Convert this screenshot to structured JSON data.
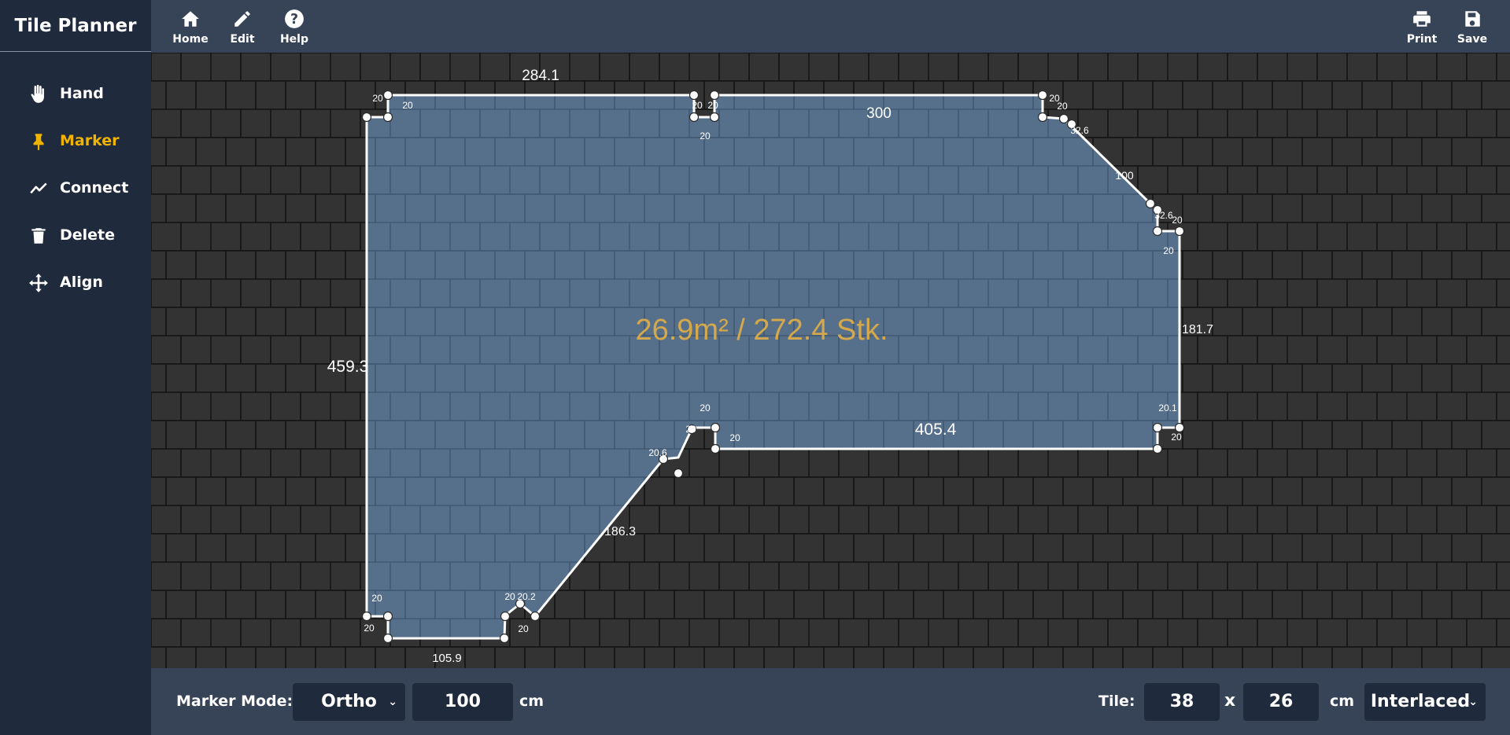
{
  "app": {
    "title": "Tile Planner"
  },
  "sidebar": {
    "items": [
      {
        "label": "Hand",
        "icon": "hand-icon",
        "active": false
      },
      {
        "label": "Marker",
        "icon": "pin-icon",
        "active": true
      },
      {
        "label": "Connect",
        "icon": "connect-icon",
        "active": false
      },
      {
        "label": "Delete",
        "icon": "trash-icon",
        "active": false
      },
      {
        "label": "Align",
        "icon": "align-icon",
        "active": false
      }
    ],
    "active_color": "#f0b400"
  },
  "toolbar": {
    "left": [
      {
        "label": "Home",
        "icon": "home-icon"
      },
      {
        "label": "Edit",
        "icon": "pencil-icon"
      },
      {
        "label": "Help",
        "icon": "help-icon"
      }
    ],
    "right": [
      {
        "label": "Print",
        "icon": "printer-icon"
      },
      {
        "label": "Save",
        "icon": "save-icon"
      }
    ]
  },
  "canvas": {
    "area_text": "26.9m² / 272.4 Stk.",
    "area_text_color": "#d4a84b",
    "room_fill_color": "#56708c",
    "background_tile_color": "#2b2b2b",
    "dimensions": {
      "top_left": "284.1",
      "top_right": "300",
      "left": "459.3",
      "right": "181.7",
      "bottom_right": "405.4",
      "bottom_left": "105.9",
      "diagonal_left": "186.3",
      "diagonal_right": "100",
      "notch_a": "20",
      "notch_b": "20.1",
      "notch_c": "20.2",
      "notch_d": "20.6",
      "notch_e": "32.6"
    }
  },
  "bottombar": {
    "marker_mode_label": "Marker Mode:",
    "marker_mode_value": "Ortho",
    "marker_length_value": "100",
    "marker_length_unit": "cm",
    "tile_label": "Tile:",
    "tile_width": "38",
    "tile_times": "x",
    "tile_height": "26",
    "tile_unit": "cm",
    "tile_pattern": "Interlaced"
  }
}
